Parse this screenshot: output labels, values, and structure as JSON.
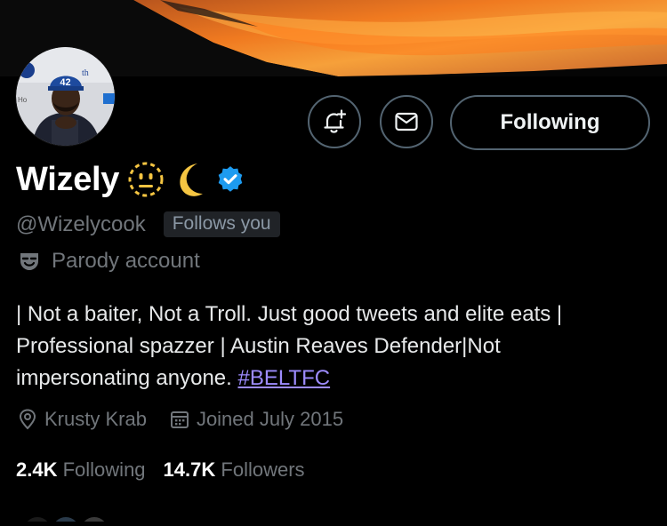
{
  "profile": {
    "name": "Wizely",
    "handle": "@Wizelycook",
    "follows_you_badge": "Follows you",
    "parody_label": "Parody account",
    "bio_lines": [
      "| Not a baiter, Not a Troll. Just good tweets and elite eats |",
      "Professional spazzer | Austin Reaves Defender|Not",
      "impersonating anyone. "
    ],
    "bio_hashtag": "#BELTFC",
    "location": "Krusty Krab",
    "joined": "Joined July 2015",
    "following_count": "2.4K",
    "following_label": "Following",
    "followers_count": "14.7K",
    "followers_label": "Followers",
    "avatar_cap_number": "42"
  },
  "actions": {
    "notify_icon": "bell-plus-icon",
    "message_icon": "envelope-icon",
    "follow_button_label": "Following"
  },
  "colors": {
    "link": "#9d8cff",
    "verified": "#1d9bf0",
    "muted": "#71767b",
    "emoji_yellow": "#f5c542"
  }
}
